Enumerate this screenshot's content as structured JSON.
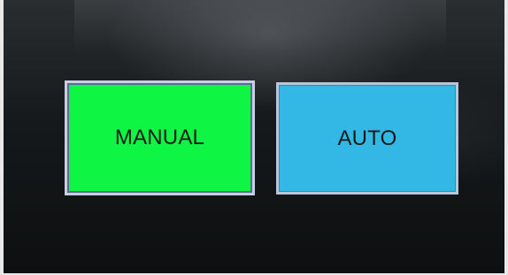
{
  "panel": {
    "buttons": [
      {
        "label": "MANUAL",
        "color": "#0ff544"
      },
      {
        "label": "AUTO",
        "color": "#33b8e6"
      }
    ]
  }
}
